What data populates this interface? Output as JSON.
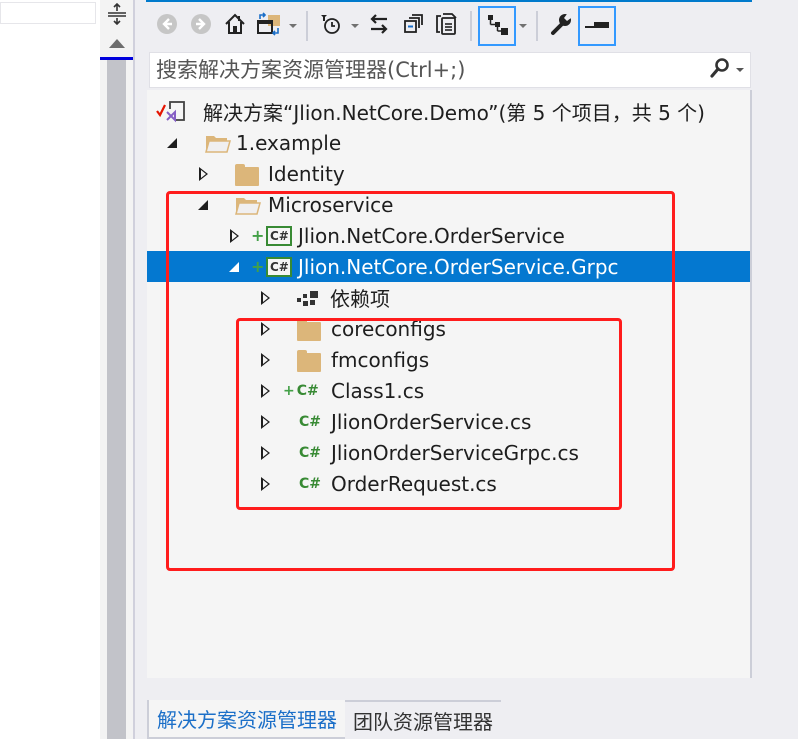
{
  "left_pane": {
    "splitter_icon": "split-vertical-icon",
    "scroll_up_icon": "scroll-up-arrow-icon"
  },
  "toolbar": {
    "buttons": [
      {
        "name": "back",
        "icon": "back-arrow-icon"
      },
      {
        "name": "forward",
        "icon": "forward-arrow-icon"
      },
      {
        "name": "home",
        "icon": "home-icon"
      },
      {
        "name": "switch-views",
        "icon": "switch-views-icon",
        "dropdown": true
      },
      {
        "name": "pending-changes-filter",
        "icon": "clock-filter-icon",
        "dropdown": true
      },
      {
        "name": "sync-with-document",
        "icon": "sync-arrows-icon"
      },
      {
        "name": "collapse-all",
        "icon": "collapse-all-icon"
      },
      {
        "name": "show-all-files",
        "icon": "copy-files-icon"
      },
      {
        "name": "show-hierarchy",
        "icon": "hierarchy-icon",
        "active": true,
        "dropdown": true
      },
      {
        "name": "properties",
        "icon": "wrench-icon"
      },
      {
        "name": "preview-selected",
        "icon": "preview-icon",
        "active": true
      }
    ]
  },
  "search": {
    "placeholder": "搜索解决方案资源管理器(Ctrl+;)",
    "value": ""
  },
  "tree": {
    "solution_label": "解决方案“Jlion.NetCore.Demo”(第 5 个项目，共 5 个)",
    "items": [
      {
        "label": "1.example",
        "type": "folder-open",
        "expanded": true,
        "level": 1
      },
      {
        "label": "Identity",
        "type": "folder",
        "expanded": false,
        "level": 2
      },
      {
        "label": "Microservice",
        "type": "folder-open",
        "expanded": true,
        "level": 2
      },
      {
        "label": "Jlion.NetCore.OrderService",
        "type": "csproj",
        "expanded": false,
        "level": 3,
        "added": true
      },
      {
        "label": "Jlion.NetCore.OrderService.Grpc",
        "type": "csproj",
        "expanded": true,
        "level": 3,
        "added": true,
        "selected": true
      },
      {
        "label": "依赖项",
        "type": "dependencies",
        "expanded": false,
        "level": 4
      },
      {
        "label": "coreconfigs",
        "type": "folder",
        "expanded": false,
        "level": 4
      },
      {
        "label": "fmconfigs",
        "type": "folder",
        "expanded": false,
        "level": 4
      },
      {
        "label": "Class1.cs",
        "type": "cs",
        "expanded": false,
        "level": 4,
        "added": true
      },
      {
        "label": "JlionOrderService.cs",
        "type": "cs",
        "expanded": false,
        "level": 4
      },
      {
        "label": "JlionOrderServiceGrpc.cs",
        "type": "cs",
        "expanded": false,
        "level": 4
      },
      {
        "label": "OrderRequest.cs",
        "type": "cs",
        "expanded": false,
        "level": 4
      }
    ]
  },
  "cs_glyph": "C#",
  "tabs": [
    {
      "label": "解决方案资源管理器",
      "active": true
    },
    {
      "label": "团队资源管理器",
      "active": false
    }
  ],
  "colors": {
    "selection": "#0478d0",
    "highlight_box": "#ff1c1c",
    "active_tab_text": "#1b6fc8",
    "folder": "#dcb67a",
    "csharp": "#388a34"
  }
}
